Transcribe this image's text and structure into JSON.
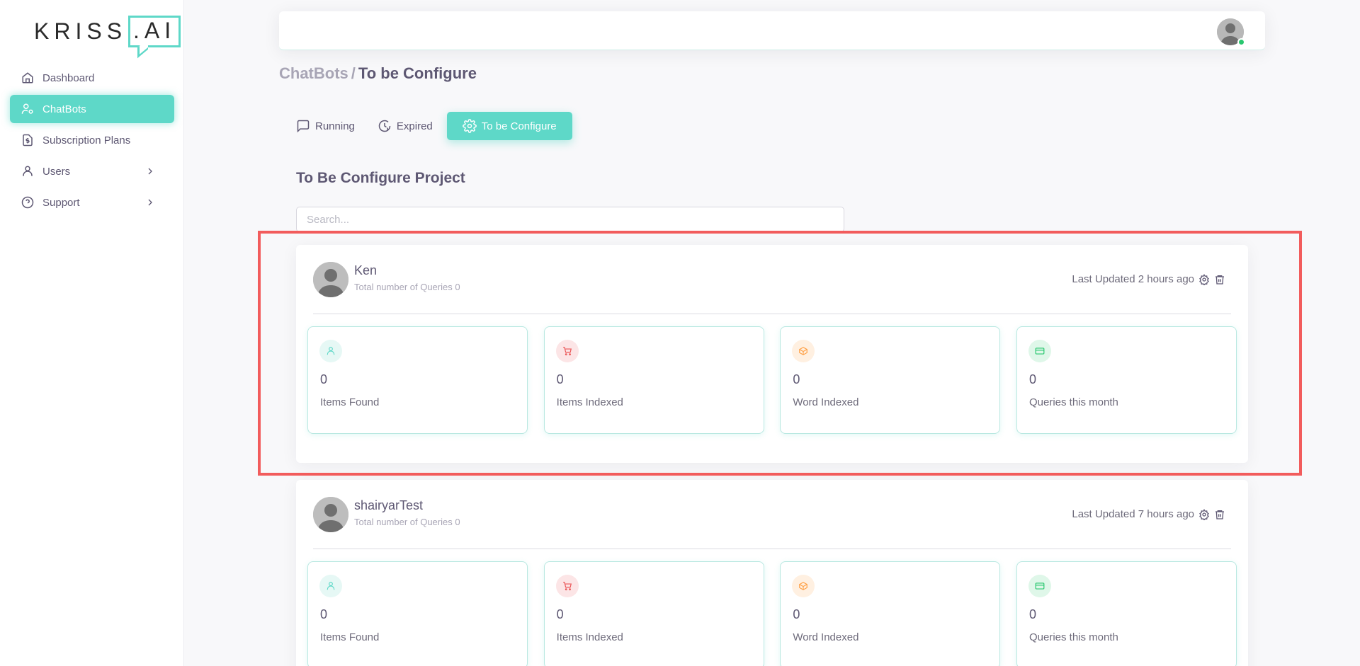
{
  "logo": {
    "text_main": "KRISS",
    "text_bubble": ".AI"
  },
  "sidebar": {
    "items": [
      {
        "label": "Dashboard",
        "icon": "home-icon"
      },
      {
        "label": "ChatBots",
        "icon": "user-settings-icon",
        "active": true
      },
      {
        "label": "Subscription Plans",
        "icon": "dollar-file-icon"
      },
      {
        "label": "Users",
        "icon": "user-icon",
        "has_submenu": true
      },
      {
        "label": "Support",
        "icon": "help-circle-icon",
        "has_submenu": true
      }
    ]
  },
  "breadcrumb": {
    "parent": "ChatBots",
    "separator": "/",
    "current": "To be Configure"
  },
  "tabs": [
    {
      "label": "Running",
      "icon": "message-square-icon"
    },
    {
      "label": "Expired",
      "icon": "clock-icon"
    },
    {
      "label": "To be Configure",
      "icon": "settings-icon",
      "active": true
    }
  ],
  "section": {
    "title": "To Be Configure Project",
    "search_placeholder": "Search..."
  },
  "projects": [
    {
      "name": "Ken",
      "subtitle": "Total number of Queries 0",
      "updated": "Last Updated 2 hours ago",
      "stats": [
        {
          "value": "0",
          "label": "Items Found",
          "icon": "user-icon"
        },
        {
          "value": "0",
          "label": "Items Indexed",
          "icon": "cart-icon"
        },
        {
          "value": "0",
          "label": "Word Indexed",
          "icon": "box-icon"
        },
        {
          "value": "0",
          "label": "Queries this month",
          "icon": "credit-card-icon"
        }
      ]
    },
    {
      "name": "shairyarTest",
      "subtitle": "Total number of Queries 0",
      "updated": "Last Updated 7 hours ago",
      "stats": [
        {
          "value": "0",
          "label": "Items Found",
          "icon": "user-icon"
        },
        {
          "value": "0",
          "label": "Items Indexed",
          "icon": "cart-icon"
        },
        {
          "value": "0",
          "label": "Word Indexed",
          "icon": "box-icon"
        },
        {
          "value": "0",
          "label": "Queries this month",
          "icon": "credit-card-icon"
        }
      ]
    }
  ],
  "colors": {
    "accent": "#5ed8c8",
    "highlight": "#f25c5c",
    "online": "#28c76f"
  }
}
